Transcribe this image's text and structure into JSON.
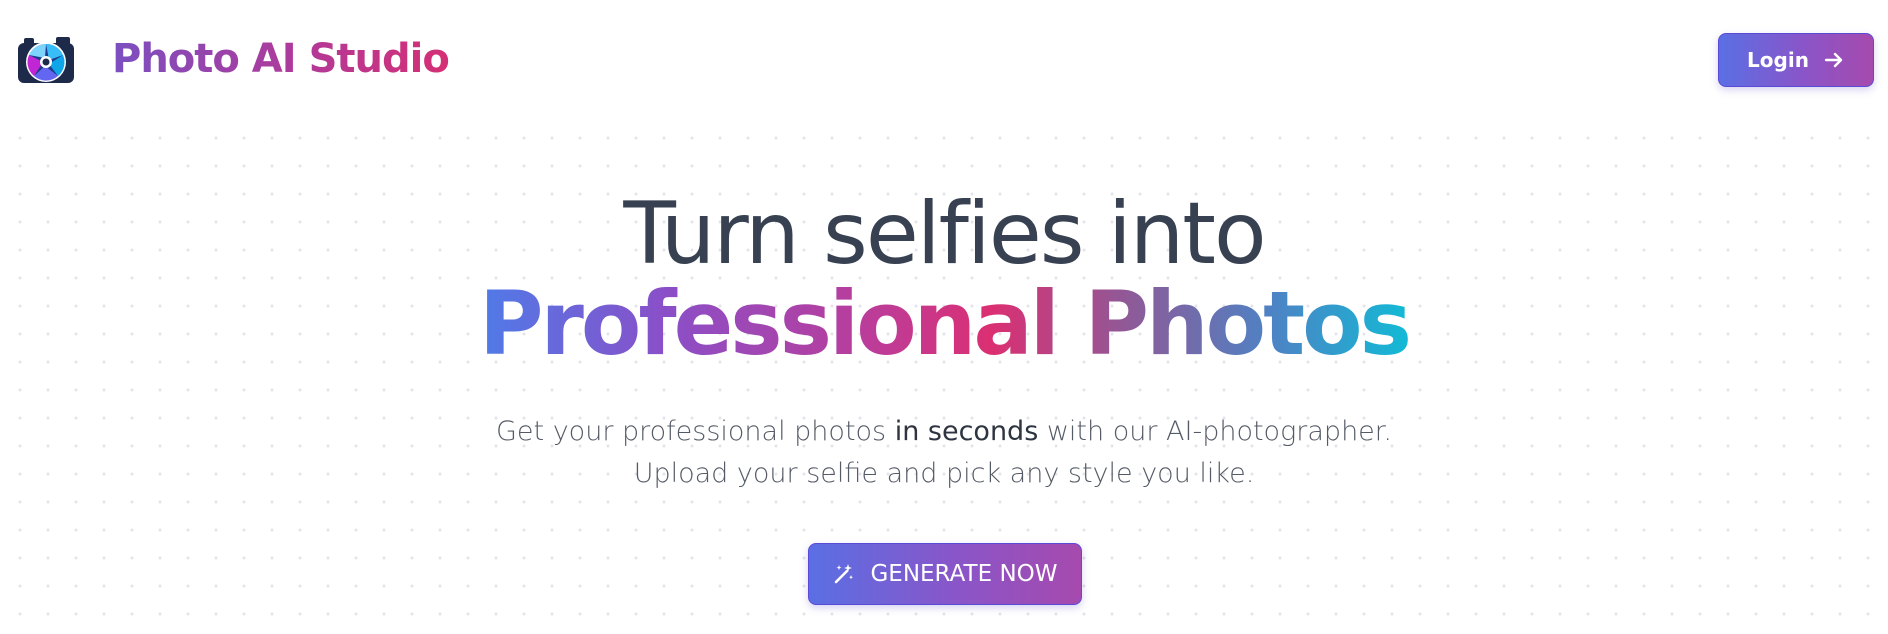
{
  "header": {
    "brand_name": "Photo AI Studio",
    "brand_tm": "™",
    "login_label": "Login",
    "logo_icon": "camera-aperture-icon",
    "login_icon": "arrow-right-icon"
  },
  "hero": {
    "title_line1": "Turn selfies into",
    "title_line2": "Professional Photos",
    "subtitle_line1_prefix": "Get your professional photos ",
    "subtitle_line1_bold": "in seconds",
    "subtitle_line1_suffix": " with our AI-photographer.",
    "subtitle_line2": "Upload your selfie and pick any style you like.",
    "cta_label": "GENERATE NOW",
    "cta_icon": "magic-wand-icon"
  },
  "colors": {
    "accent_start": "#5a6fe4",
    "accent_end": "#a64aae",
    "heading": "#374151",
    "brand_pink": "#d52f74",
    "brand_cyan": "#12bad6"
  }
}
